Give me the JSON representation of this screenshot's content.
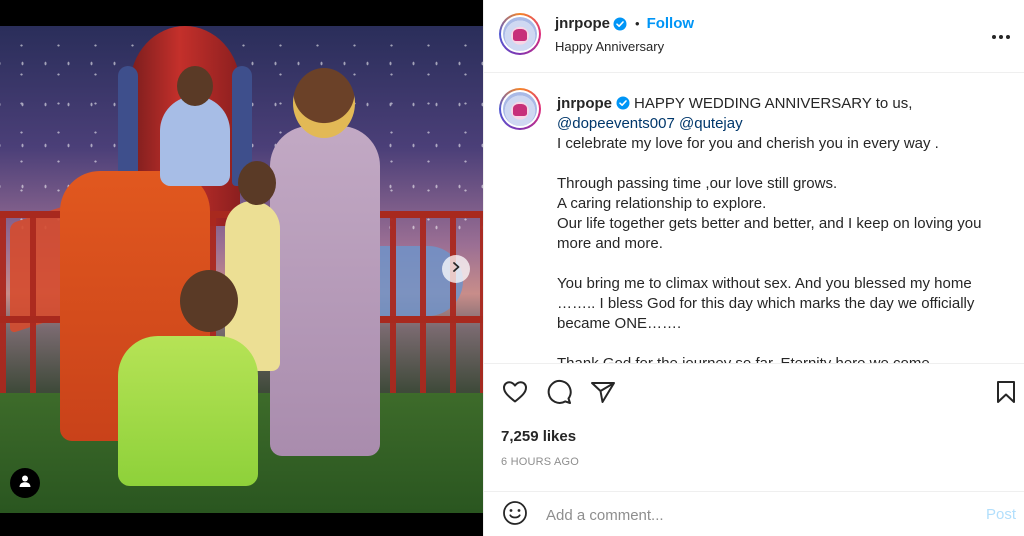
{
  "post": {
    "username": "jnrpope",
    "verified": true,
    "follow_label": "Follow",
    "separator": "•",
    "subtitle": "Happy Anniversary",
    "more_icon": "more-horizontal-icon"
  },
  "caption": {
    "username": "jnrpope",
    "intro": "HAPPY WEDDING ANNIVERSARY to us,",
    "mention_1": "@dopeevents007",
    "mention_2": "@qutejay",
    "line_1": "I celebrate my love for you and cherish you in every way .",
    "line_2": "Through passing time ,our love still grows.",
    "line_3": "A caring relationship to explore.",
    "line_4": "Our life together gets better and better, and I keep on loving you more and more.",
    "line_5": "You bring me to climax without sex. And you blessed my home …….. I bless God for this day which marks the day we officially became ONE…….",
    "line_6": "Thank God for the journey so far. Eternity here we come"
  },
  "actions": {
    "like_icon": "heart-icon",
    "comment_icon": "comment-icon",
    "share_icon": "paper-plane-icon",
    "save_icon": "bookmark-icon"
  },
  "stats": {
    "likes": "7,259 likes",
    "time": "6 HOURS AGO"
  },
  "comment": {
    "placeholder": "Add a comment...",
    "post_label": "Post",
    "emoji_icon": "smiley-icon"
  },
  "media": {
    "next_icon": "chevron-right-icon",
    "tag_icon": "user-tag-icon"
  },
  "colors": {
    "accent": "#0095f6",
    "post_disabled": "#b2dffc",
    "mention": "#00376b",
    "muted": "#8e8e8e"
  }
}
